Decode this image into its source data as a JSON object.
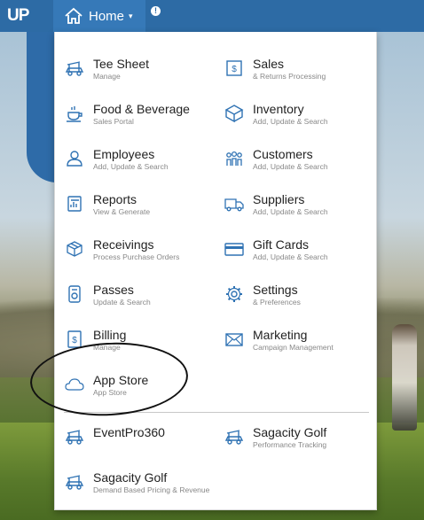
{
  "topbar": {
    "logo": "UP",
    "home_label": "Home",
    "caret": "▾",
    "alert": "!"
  },
  "menu": {
    "items": [
      {
        "title": "Tee Sheet",
        "sub": "Manage",
        "icon": "golf-cart-icon"
      },
      {
        "title": "Sales",
        "sub": "& Returns Processing",
        "icon": "register-icon"
      },
      {
        "title": "Food & Beverage",
        "sub": "Sales Portal",
        "icon": "coffee-cup-icon"
      },
      {
        "title": "Inventory",
        "sub": "Add, Update & Search",
        "icon": "box-icon"
      },
      {
        "title": "Employees",
        "sub": "Add, Update & Search",
        "icon": "employee-icon"
      },
      {
        "title": "Customers",
        "sub": "Add, Update & Search",
        "icon": "customers-icon"
      },
      {
        "title": "Reports",
        "sub": "View & Generate",
        "icon": "report-icon"
      },
      {
        "title": "Suppliers",
        "sub": "Add, Update & Search",
        "icon": "truck-icon"
      },
      {
        "title": "Receivings",
        "sub": "Process Purchase Orders",
        "icon": "package-icon"
      },
      {
        "title": "Gift Cards",
        "sub": "Add, Update & Search",
        "icon": "card-icon"
      },
      {
        "title": "Passes",
        "sub": "Update & Search",
        "icon": "pass-icon"
      },
      {
        "title": "Settings",
        "sub": "& Preferences",
        "icon": "gear-icon"
      },
      {
        "title": "Billing",
        "sub": "Manage",
        "icon": "billing-icon"
      },
      {
        "title": "Marketing",
        "sub": "Campaign Management",
        "icon": "envelope-icon"
      },
      {
        "title": "App Store",
        "sub": "App Store",
        "icon": "cloud-icon"
      },
      {
        "title": "EventPro360",
        "sub": "",
        "icon": "golf-cart-icon"
      },
      {
        "title": "Sagacity Golf",
        "sub": "Performance Tracking",
        "icon": "golf-cart-icon"
      },
      {
        "title": "Sagacity Golf",
        "sub": "Demand Based Pricing & Revenue",
        "icon": "golf-cart-icon"
      }
    ]
  },
  "colors": {
    "topbar": "#2d6ba5",
    "icon": "#2f72b3"
  }
}
